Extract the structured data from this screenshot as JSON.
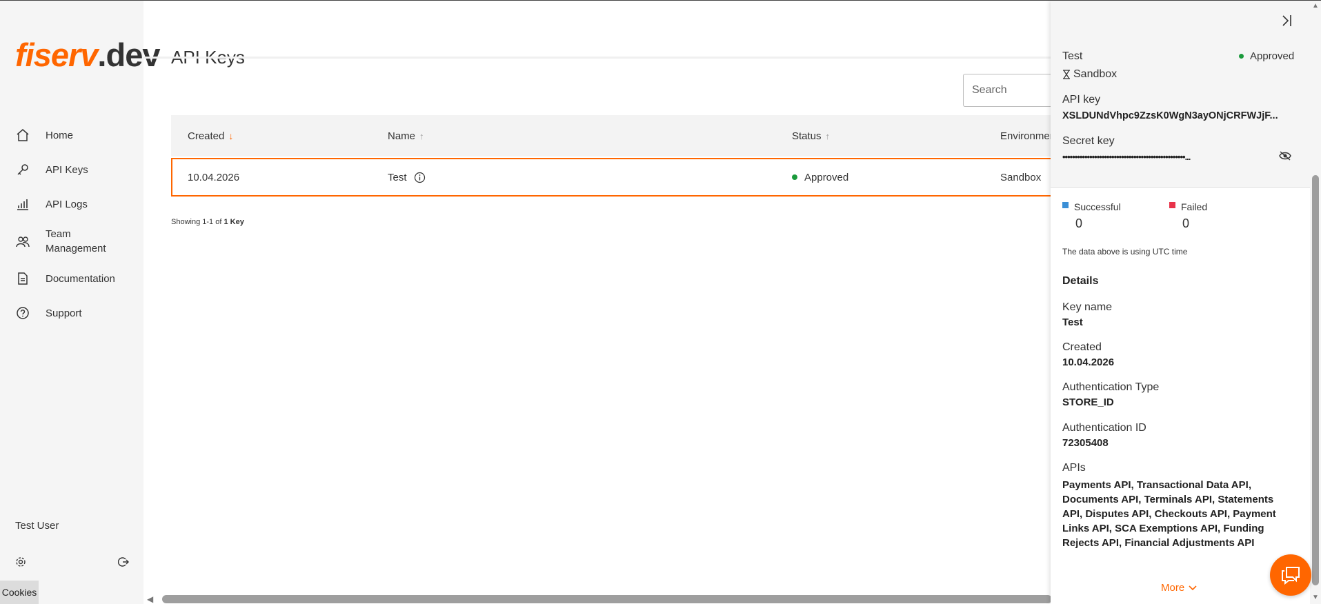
{
  "brand": {
    "logo_part1": "fiserv",
    "logo_part2": ".dev",
    "accent": "#ff6600"
  },
  "sidebar": {
    "items": [
      {
        "label": "Home",
        "icon": "home-icon"
      },
      {
        "label": "API Keys",
        "icon": "key-icon"
      },
      {
        "label": "API Logs",
        "icon": "bar-chart-icon"
      },
      {
        "label": "Team Management",
        "icon": "team-icon"
      },
      {
        "label": "Documentation",
        "icon": "document-icon"
      },
      {
        "label": "Support",
        "icon": "help-icon"
      }
    ],
    "user_name": "Test User",
    "cookies_label": "Cookies"
  },
  "main": {
    "title": "API Keys",
    "search_placeholder": "Search",
    "columns": {
      "created": "Created",
      "name": "Name",
      "status": "Status",
      "environment": "Environment"
    },
    "rows": [
      {
        "created": "10.04.2026",
        "name": "Test",
        "status": "Approved",
        "environment": "Sandbox"
      }
    ],
    "showing_prefix": "Showing 1-1 of",
    "showing_count": "1 Key"
  },
  "panel": {
    "key_name": "Test",
    "status": "Approved",
    "environment": "Sandbox",
    "api_key_label": "API key",
    "api_key_value": "XSLDUNdVhpc9ZzsK0WgN3ayONjCRFWJjF...",
    "secret_key_label": "Secret key",
    "secret_key_value": "••••••••••••••••••••••••••••••••••••••••••••••••••...",
    "successful_label": "Successful",
    "successful_value": "0",
    "failed_label": "Failed",
    "failed_value": "0",
    "successful_color": "#3b8fd6",
    "failed_color": "#e8334a",
    "utc_note": "The data above is using UTC time",
    "details_heading": "Details",
    "details": {
      "key_name_label": "Key name",
      "key_name_value": "Test",
      "created_label": "Created",
      "created_value": "10.04.2026",
      "auth_type_label": "Authentication Type",
      "auth_type_value": "STORE_ID",
      "auth_id_label": "Authentication ID",
      "auth_id_value": "72305408",
      "apis_label": "APIs",
      "apis_value": "Payments API, Transactional Data API, Documents API, Terminals API, Statements API, Disputes API, Checkouts API, Payment Links API, SCA Exemptions API, Funding Rejects API, Financial Adjustments API"
    },
    "more_label": "More"
  }
}
